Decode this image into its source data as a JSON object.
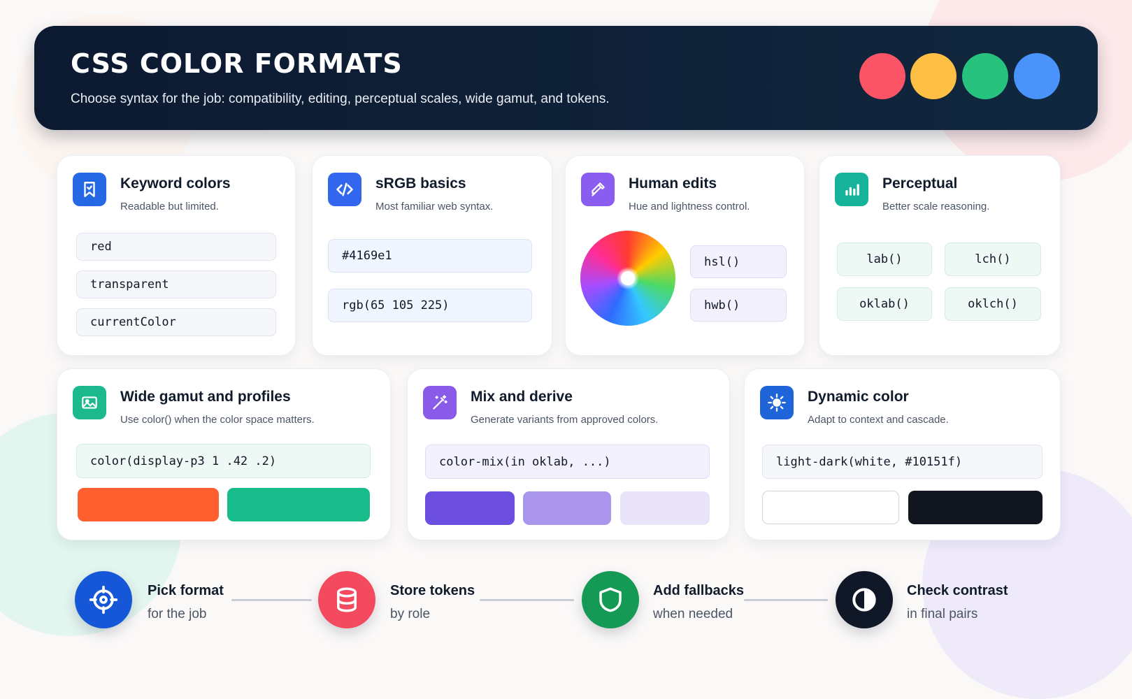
{
  "header": {
    "title": "CSS COLOR FORMATS",
    "subtitle": "Choose syntax for the job: compatibility, editing, perceptual scales, wide gamut, and tokens.",
    "dots": [
      "#fb5466",
      "#fdc044",
      "#27c27e",
      "#4a93fb"
    ]
  },
  "cards": {
    "keyword": {
      "title": "Keyword colors",
      "subtitle": "Readable but limited.",
      "icon": "bookmark-icon",
      "icon_color": "#2468e3",
      "values": [
        "red",
        "transparent",
        "currentColor"
      ]
    },
    "srgb": {
      "title": "sRGB basics",
      "subtitle": "Most familiar web syntax.",
      "icon": "code-icon",
      "icon_color": "#3366ee",
      "values": [
        "#4169e1",
        "rgb(65 105 225)"
      ]
    },
    "human": {
      "title": "Human edits",
      "subtitle": "Hue and lightness control.",
      "icon": "eyedropper-icon",
      "icon_color": "#8a5cf0",
      "values": [
        "hsl()",
        "hwb()"
      ]
    },
    "perceptual": {
      "title": "Perceptual",
      "subtitle": "Better scale reasoning.",
      "icon": "bar-chart-icon",
      "icon_color": "#16b39a",
      "values": [
        "lab()",
        "lch()",
        "oklab()",
        "oklch()"
      ]
    },
    "wide": {
      "title": "Wide gamut and profiles",
      "subtitle": "Use color() when the color space matters.",
      "icon": "image-icon",
      "icon_color": "#1db98e",
      "code": "color(display-p3 1 .42 .2)",
      "swatches": [
        "#ff5f2e",
        "#18bc8a"
      ]
    },
    "mix": {
      "title": "Mix and derive",
      "subtitle": "Generate variants from approved colors.",
      "icon": "magic-wand-icon",
      "icon_color": "#8a5be8",
      "code": "color-mix(in oklab, ...)",
      "swatches": [
        "#6c4fe0",
        "#a996ec",
        "#e8e3f9"
      ]
    },
    "dynamic": {
      "title": "Dynamic color",
      "subtitle": "Adapt to context and cascade.",
      "icon": "sun-icon",
      "icon_color": "#1f64d8",
      "code": "light-dark(white, #10151f)",
      "swatches": [
        "#ffffff",
        "#10151f"
      ]
    }
  },
  "steps": [
    {
      "title": "Pick format",
      "subtitle": "for the job",
      "icon": "crosshair-icon",
      "color": "#1557d6"
    },
    {
      "title": "Store tokens",
      "subtitle": "by role",
      "icon": "database-icon",
      "color": "#f44a5f"
    },
    {
      "title": "Add fallbacks",
      "subtitle": "when needed",
      "icon": "shield-icon",
      "color": "#159a55"
    },
    {
      "title": "Check contrast",
      "subtitle": "in final pairs",
      "icon": "contrast-icon",
      "color": "#101726"
    }
  ]
}
